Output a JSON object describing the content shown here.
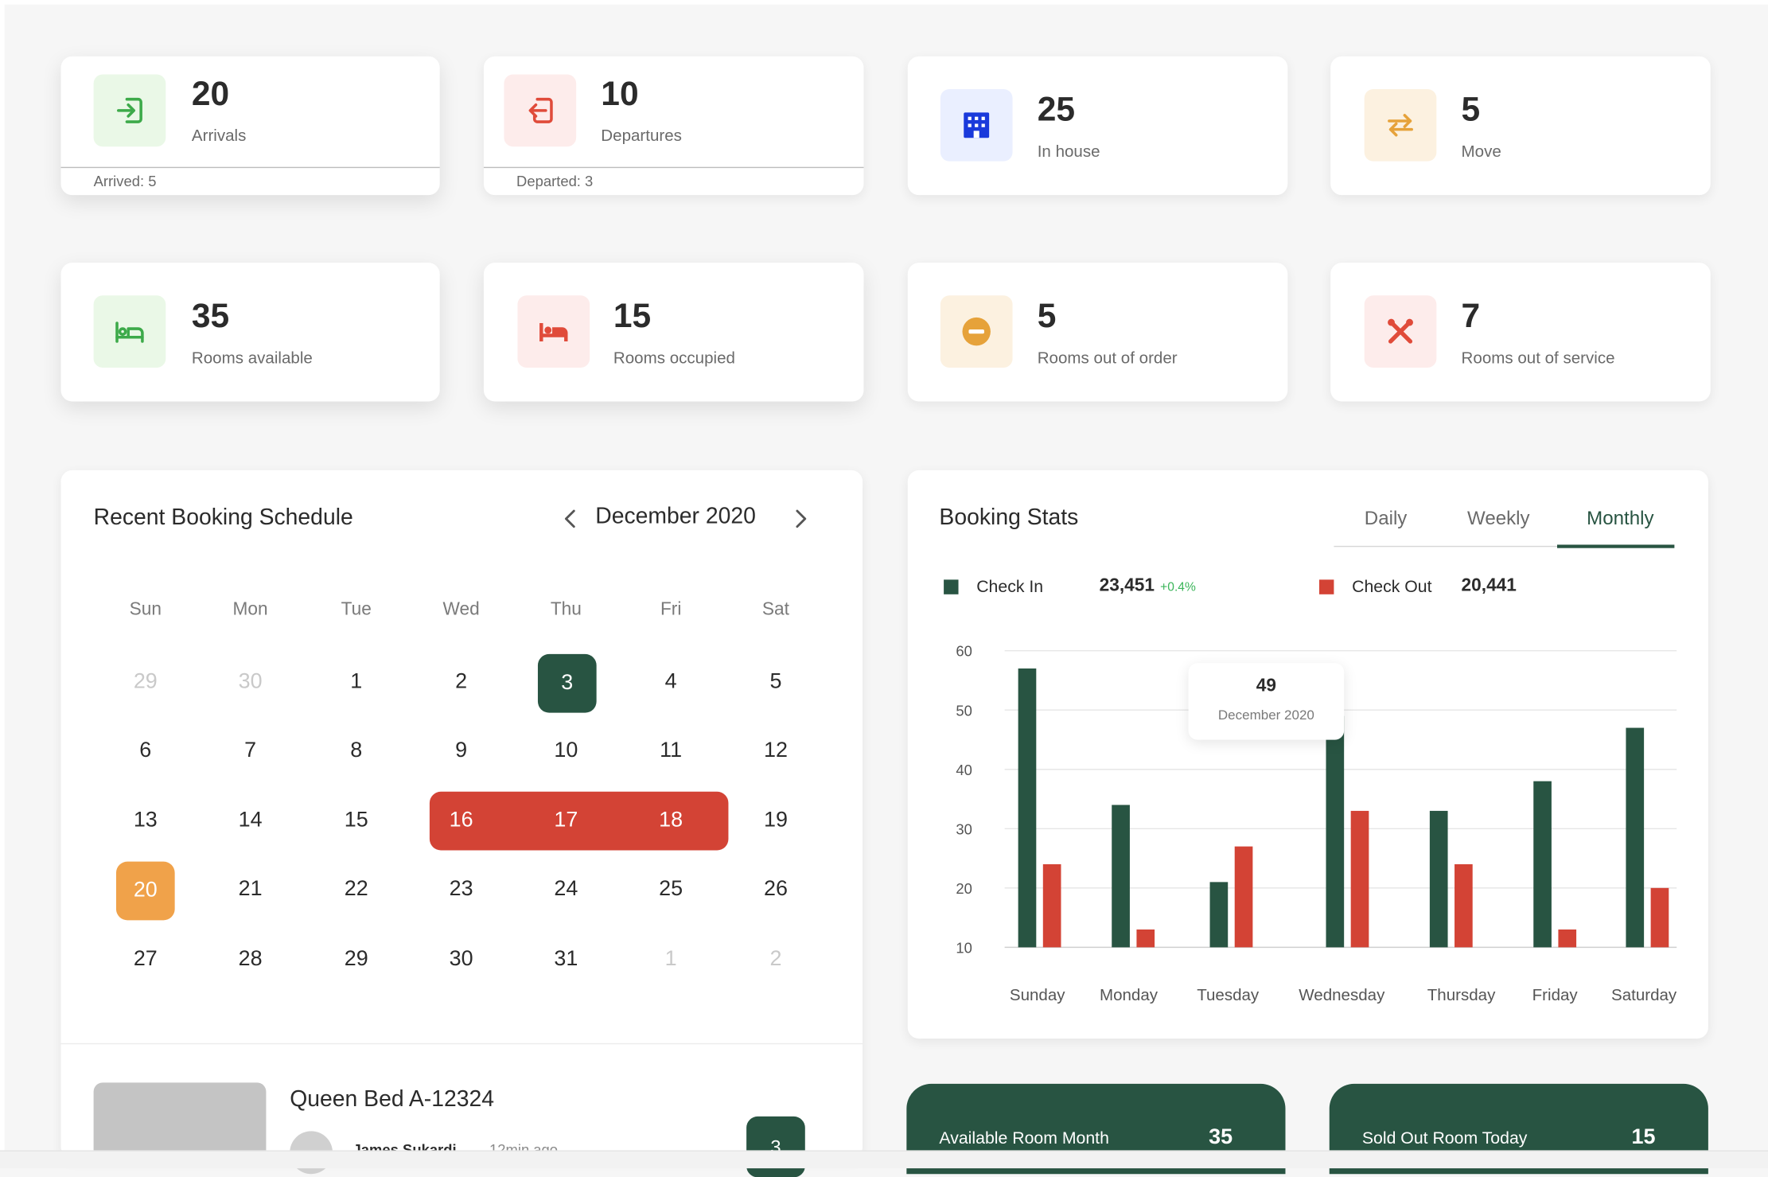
{
  "stats": [
    {
      "value": "20",
      "label": "Arrivals",
      "footer": "Arrived: 5",
      "icon": "arrival-icon",
      "color": "#3daa4a",
      "bg": "#eaf8e7"
    },
    {
      "value": "10",
      "label": "Departures",
      "footer": "Departed: 3",
      "icon": "departure-icon",
      "color": "#e04b3a",
      "bg": "#fdeceb"
    },
    {
      "value": "25",
      "label": "In house",
      "icon": "building-icon",
      "color": "#1a3adb",
      "bg": "#eaefff"
    },
    {
      "value": "5",
      "label": "Move",
      "icon": "swap-arrows-icon",
      "color": "#e6a23a",
      "bg": "#fcf1e0"
    },
    {
      "value": "35",
      "label": "Rooms available",
      "icon": "bed-icon",
      "color": "#3daa4a",
      "bg": "#eaf8e7"
    },
    {
      "value": "15",
      "label": "Rooms occupied",
      "icon": "bed-occupied-icon",
      "color": "#e04b3a",
      "bg": "#fdeceb"
    },
    {
      "value": "5",
      "label": "Rooms out of order",
      "icon": "no-entry-icon",
      "color": "#e6a23a",
      "bg": "#fcf1e0"
    },
    {
      "value": "7",
      "label": "Rooms out of service",
      "icon": "tools-icon",
      "color": "#e04b3a",
      "bg": "#fdeceb"
    }
  ],
  "calendar": {
    "title": "Recent Booking Schedule",
    "month": "December 2020",
    "weekdays": [
      "Sun",
      "Mon",
      "Tue",
      "Wed",
      "Thu",
      "Fri",
      "Sat"
    ],
    "weeks": [
      [
        "29",
        "30",
        "1",
        "2",
        "3",
        "4",
        "5"
      ],
      [
        "6",
        "7",
        "8",
        "9",
        "10",
        "11",
        "12"
      ],
      [
        "13",
        "14",
        "15",
        "16",
        "17",
        "18",
        "19"
      ],
      [
        "20",
        "21",
        "22",
        "23",
        "24",
        "25",
        "26"
      ],
      [
        "27",
        "28",
        "29",
        "30",
        "31",
        "1",
        "2"
      ]
    ]
  },
  "booking": {
    "room": "Queen Bed A-12324",
    "guest": "James Sukardi",
    "time": "12min ago",
    "badge": "3"
  },
  "booking_stats": {
    "title": "Booking Stats",
    "tabs": [
      "Daily",
      "Weekly",
      "Monthly"
    ],
    "active_tab": "Monthly",
    "checkin_label": "Check In",
    "checkin_value": "23,451",
    "checkin_delta": "+0.4%",
    "checkout_label": "Check Out",
    "checkout_value": "20,441",
    "tooltip_value": "49",
    "tooltip_date": "December 2020",
    "colors": {
      "checkin": "#285442",
      "checkout": "#d34335"
    }
  },
  "chart_data": {
    "type": "bar",
    "categories": [
      "Sunday",
      "Monday",
      "Tuesday",
      "Wednesday",
      "Thursday",
      "Friday",
      "Saturday"
    ],
    "series": [
      {
        "name": "Check In",
        "values": [
          57,
          34,
          21,
          49,
          33,
          38,
          47
        ]
      },
      {
        "name": "Check Out",
        "values": [
          24,
          13,
          27,
          33,
          24,
          13,
          20
        ]
      }
    ],
    "ylim": [
      10,
      60
    ],
    "yticks": [
      "60",
      "50",
      "40",
      "30",
      "20",
      "10"
    ],
    "grid": true
  },
  "summary": [
    {
      "label": "Available Room Month",
      "value": "35"
    },
    {
      "label": "Sold Out Room Today",
      "value": "15"
    }
  ]
}
